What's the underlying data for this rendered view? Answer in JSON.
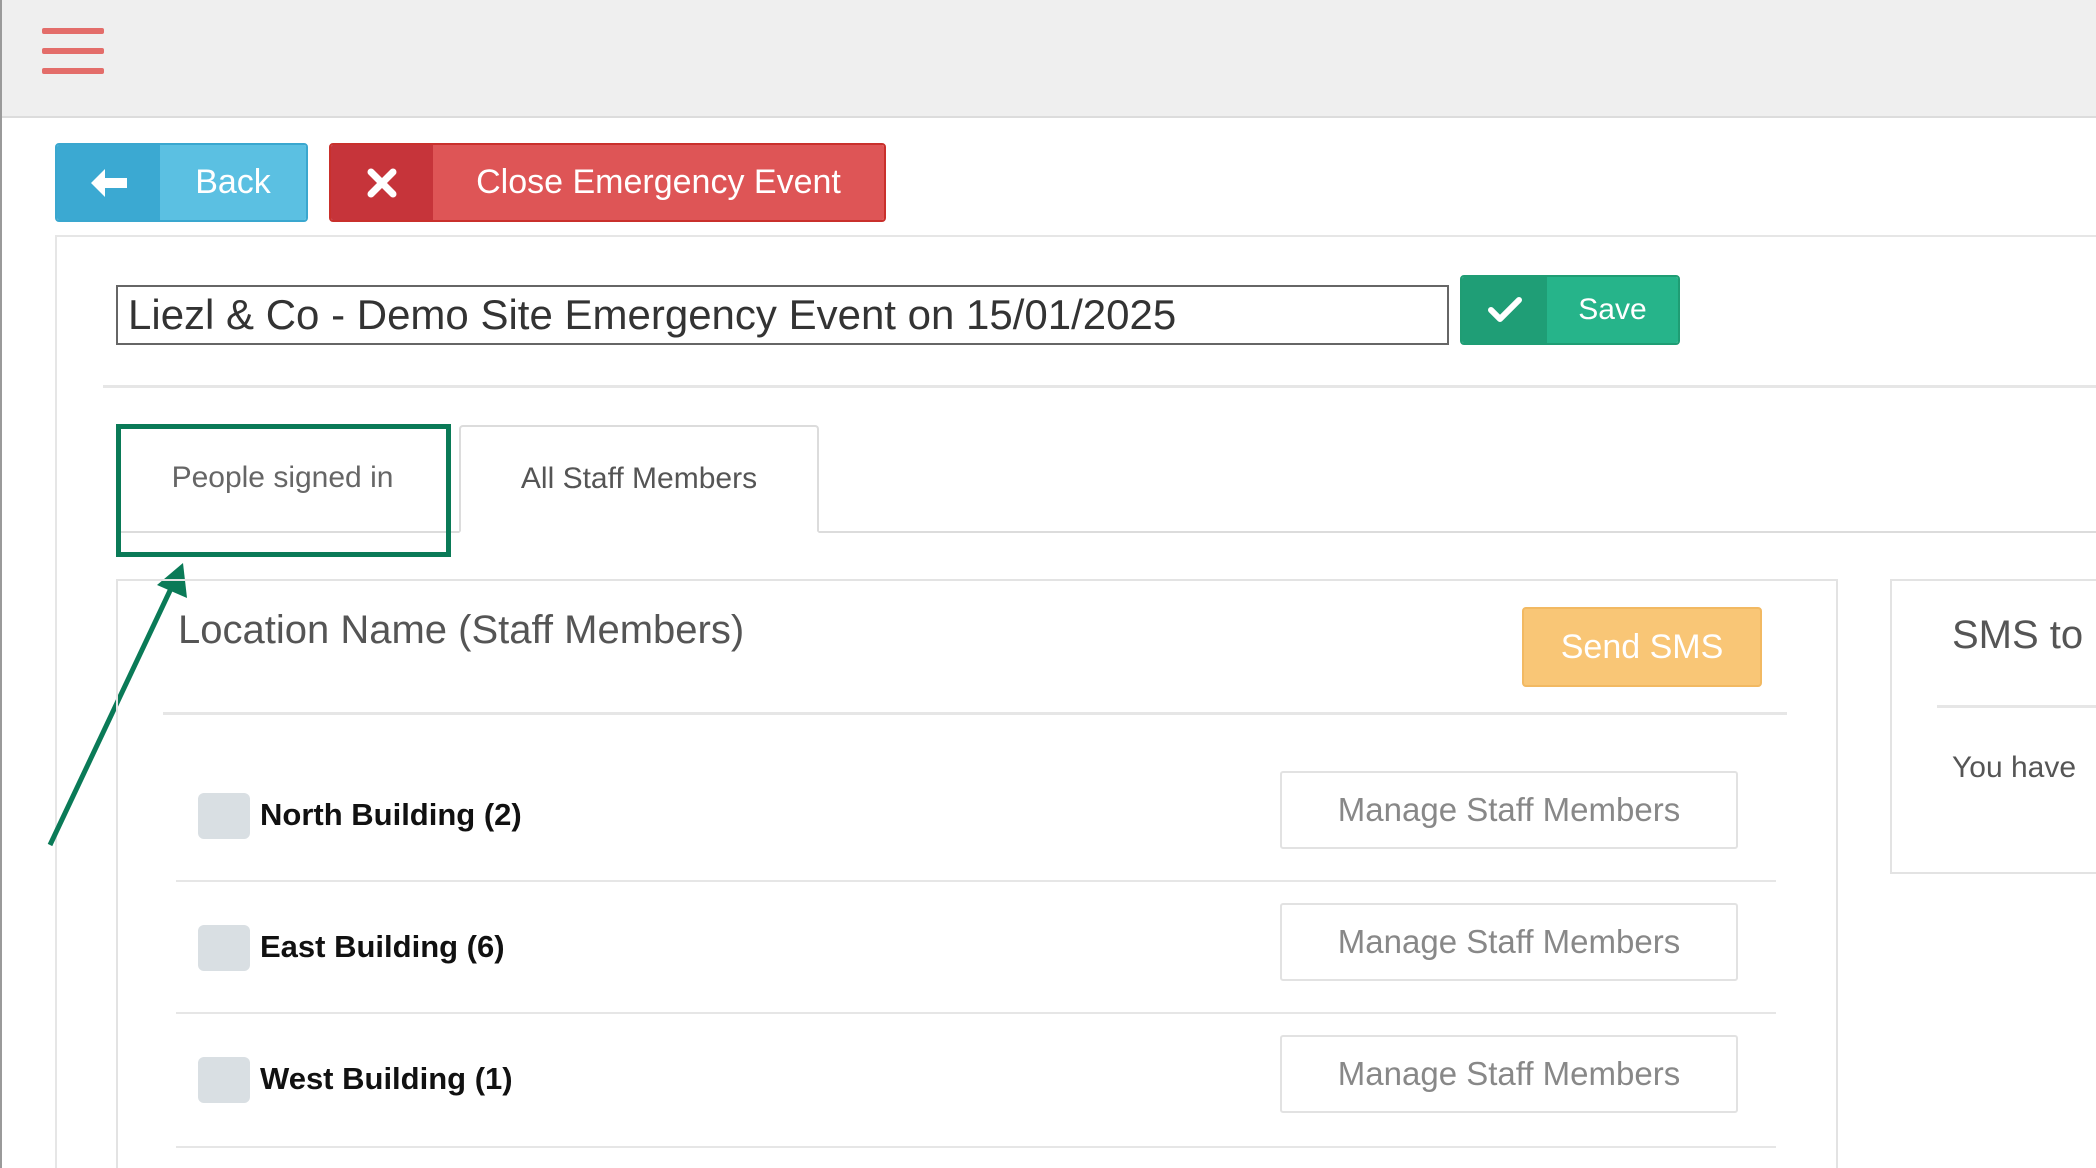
{
  "header": {
    "menu_icon": "hamburger-icon"
  },
  "actions": {
    "back_label": "Back",
    "back_icon": "arrow-left-icon",
    "close_label": "Close Emergency Event",
    "close_icon": "close-icon"
  },
  "event": {
    "title_value": "Liezl & Co - Demo Site Emergency Event on 15/01/2025",
    "save_label": "Save",
    "save_icon": "check-icon"
  },
  "tabs": [
    {
      "label": "People signed in",
      "active": false
    },
    {
      "label": "All Staff Members",
      "active": true
    }
  ],
  "locations": {
    "title": "Location Name (Staff Members)",
    "send_sms_label": "Send SMS",
    "rows": [
      {
        "name": "North Building (2)",
        "action": "Manage Staff Members"
      },
      {
        "name": "East Building (6)",
        "action": "Manage Staff Members"
      },
      {
        "name": "West Building (1)",
        "action": "Manage Staff Members"
      }
    ]
  },
  "sms_panel": {
    "title": "SMS to",
    "text": "You have"
  },
  "colors": {
    "accent_info": "#5bc0e2",
    "accent_danger": "#de5556",
    "accent_success": "#26b48a",
    "accent_warning": "#f9c676",
    "annotation": "#0a7a57",
    "menu": "#e36d6a"
  }
}
